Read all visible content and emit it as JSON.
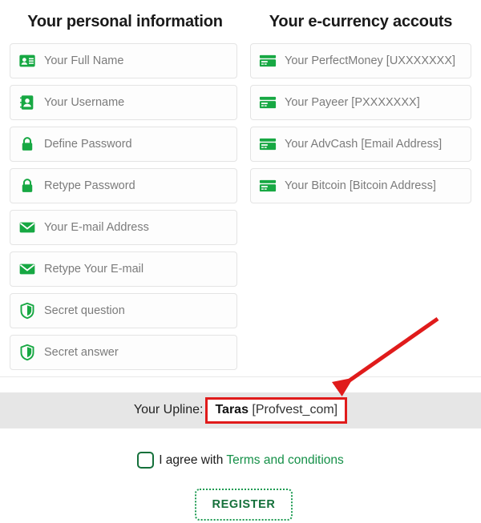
{
  "colors": {
    "icon_green": "#17a843",
    "link_green": "#159048",
    "button_green": "#14703a",
    "annotation_red": "#e01b1b",
    "band_gray": "#e6e6e6",
    "placeholder_gray": "#7b7b7b"
  },
  "personal": {
    "title": "Your personal information",
    "fields": [
      {
        "placeholder": "Your Full Name",
        "icon": "id-card-icon",
        "name": "full-name-input"
      },
      {
        "placeholder": "Your Username",
        "icon": "user-card-icon",
        "name": "username-input"
      },
      {
        "placeholder": "Define Password",
        "icon": "lock-icon",
        "name": "password-input"
      },
      {
        "placeholder": "Retype Password",
        "icon": "lock-icon",
        "name": "retype-password-input"
      },
      {
        "placeholder": "Your E-mail Address",
        "icon": "envelope-icon",
        "name": "email-input"
      },
      {
        "placeholder": "Retype Your E-mail",
        "icon": "envelope-icon",
        "name": "retype-email-input"
      },
      {
        "placeholder": "Secret question",
        "icon": "shield-icon",
        "name": "secret-question-input"
      },
      {
        "placeholder": "Secret answer",
        "icon": "shield-icon",
        "name": "secret-answer-input"
      }
    ]
  },
  "ecurrency": {
    "title": "Your e-currency accouts",
    "fields": [
      {
        "placeholder": "Your PerfectMoney [UXXXXXXX]",
        "icon": "credit-card-icon",
        "name": "perfectmoney-input"
      },
      {
        "placeholder": "Your Payeer [PXXXXXXX]",
        "icon": "credit-card-icon",
        "name": "payeer-input"
      },
      {
        "placeholder": "Your AdvCash [Email Address]",
        "icon": "credit-card-icon",
        "name": "advcash-input"
      },
      {
        "placeholder": "Your Bitcoin [Bitcoin Address]",
        "icon": "credit-card-icon",
        "name": "bitcoin-input"
      }
    ]
  },
  "upline": {
    "label": "Your Upline:",
    "name": "Taras",
    "id": "[Profvest_com]"
  },
  "agree": {
    "text": "I agree with",
    "link": "Terms and conditions",
    "checked": false
  },
  "register": {
    "label": "REGISTER"
  }
}
